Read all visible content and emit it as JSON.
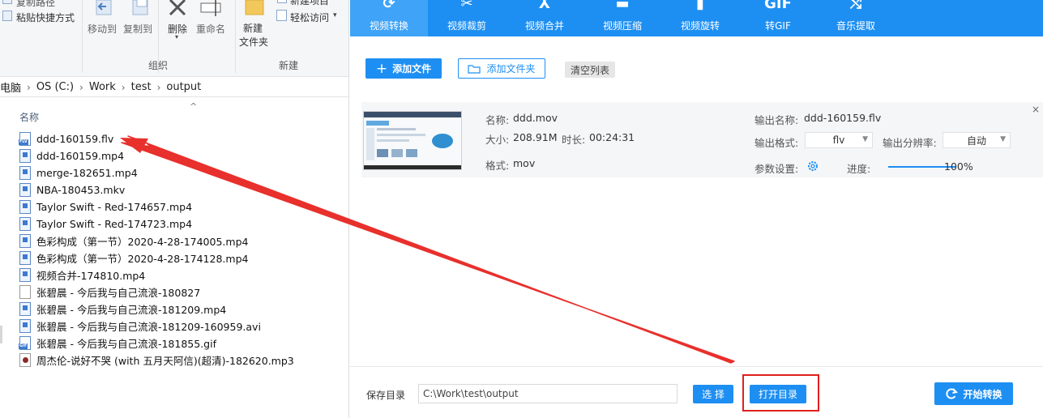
{
  "explorer": {
    "ribbon": {
      "copy_path": "复制路径",
      "paste_shortcut": "粘贴快捷方式",
      "move_to": "移动到",
      "copy_to": "复制到",
      "delete": "删除",
      "rename": "重命名",
      "new_folder_line1": "新建",
      "new_folder_line2": "文件夹",
      "new_item": "新建项目",
      "easy_access": "轻松访问",
      "group_organize": "组织",
      "group_new": "新建"
    },
    "breadcrumb": [
      "此电脑",
      "OS (C:)",
      "Work",
      "test",
      "output"
    ],
    "column_name": "名称",
    "files": [
      {
        "name": "ddd-160159.flv",
        "type": "flv"
      },
      {
        "name": "ddd-160159.mp4",
        "type": "video"
      },
      {
        "name": "merge-182651.mp4",
        "type": "video"
      },
      {
        "name": "NBA-180453.mkv",
        "type": "video"
      },
      {
        "name": "Taylor Swift - Red-174657.mp4",
        "type": "video"
      },
      {
        "name": "Taylor Swift - Red-174723.mp4",
        "type": "video"
      },
      {
        "name": "色彩构成（第一节）2020-4-28-174005.mp4",
        "type": "video"
      },
      {
        "name": "色彩构成（第一节）2020-4-28-174128.mp4",
        "type": "video"
      },
      {
        "name": "视频合并-174810.mp4",
        "type": "video"
      },
      {
        "name": "张碧晨 - 今后我与自己流浪-180827",
        "type": "blank"
      },
      {
        "name": "张碧晨 - 今后我与自己流浪-181209.mp4",
        "type": "video"
      },
      {
        "name": "张碧晨 - 今后我与自己流浪-181209-160959.avi",
        "type": "video"
      },
      {
        "name": "张碧晨 - 今后我与自己流浪-181855.gif",
        "type": "gif"
      },
      {
        "name": "周杰伦-说好不哭 (with 五月天阿信)(超清)-182620.mp3",
        "type": "mp3"
      }
    ]
  },
  "app": {
    "nav": [
      {
        "label": "视频转换",
        "icon": "convert-icon",
        "glyph": "⟳",
        "active": true
      },
      {
        "label": "视频裁剪",
        "icon": "scissors-icon",
        "glyph": "✂",
        "active": false
      },
      {
        "label": "视频合并",
        "icon": "merge-icon",
        "glyph": "⅄",
        "active": false
      },
      {
        "label": "视频压缩",
        "icon": "compress-icon",
        "glyph": "▬",
        "active": false
      },
      {
        "label": "视频旋转",
        "icon": "rotate-icon",
        "glyph": "▮",
        "active": false
      },
      {
        "label": "转GIF",
        "icon": "gif-icon",
        "glyph": "GIF",
        "active": false
      },
      {
        "label": "音乐提取",
        "icon": "music-extract-icon",
        "glyph": "⤭",
        "active": false
      }
    ],
    "toolbar": {
      "add_file": "添加文件",
      "add_file_icon": "+",
      "add_folder": "添加文件夹",
      "clear_list": "清空列表"
    },
    "card": {
      "name_label": "名称:",
      "name_value": "ddd.mov",
      "size_label": "大小:",
      "size_value": "208.91M",
      "duration_label": "时长:",
      "duration_value": "00:24:31",
      "format_label": "格式:",
      "format_value": "mov",
      "output_name_label": "输出名称:",
      "output_name_value": "ddd-160159.flv",
      "output_format_label": "输出格式:",
      "output_format_value": "flv",
      "output_resolution_label": "输出分辨率:",
      "output_resolution_value": "自动",
      "params_label": "参数设置:",
      "progress_label": "进度:",
      "progress_value": "100%",
      "progress_fraction": 1.0,
      "close_glyph": "×"
    },
    "footer": {
      "save_dir_label": "保存目录",
      "save_dir_value": "C:\\Work\\test\\output",
      "choose_button": "选 择",
      "open_dir_button": "打开目录",
      "start_button": "开始转换"
    },
    "colors": {
      "primary": "#1e8ff2",
      "highlight_box": "#e0201e",
      "annotation_arrow": "#e8302c"
    }
  }
}
